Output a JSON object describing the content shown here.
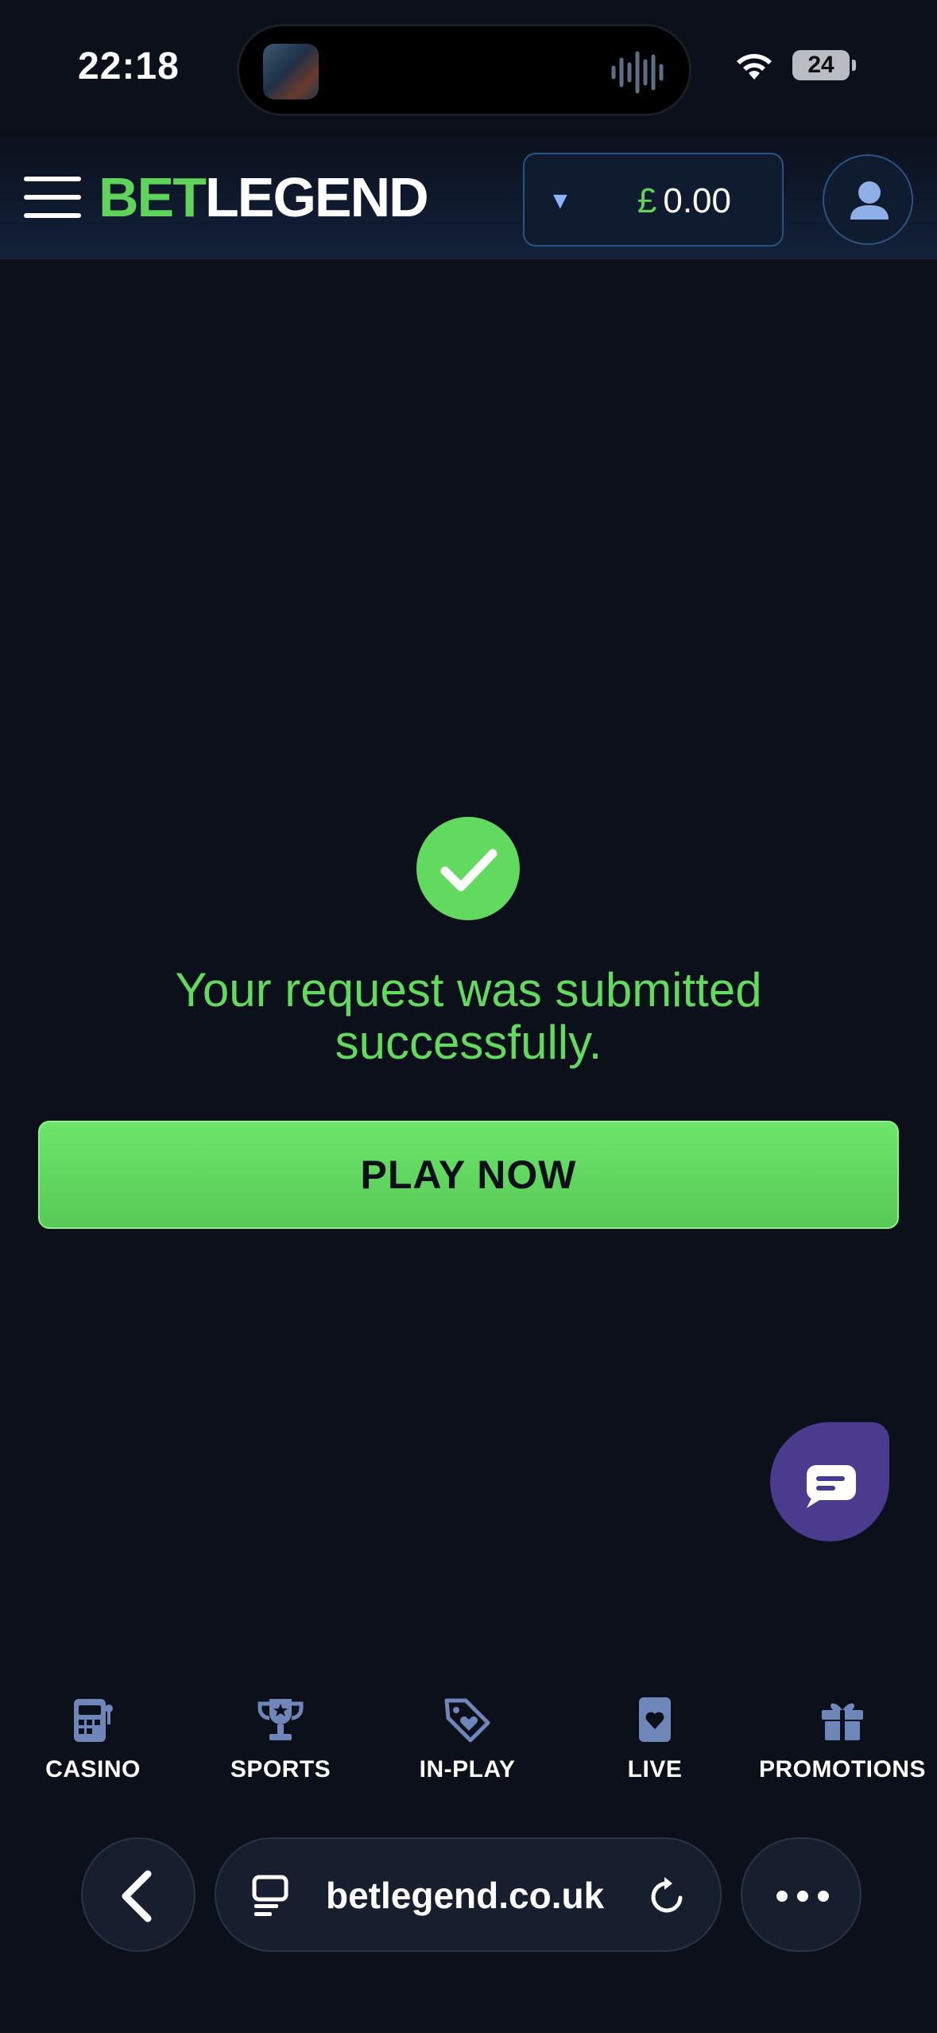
{
  "status_bar": {
    "time": "22:18",
    "battery": "24"
  },
  "header": {
    "logo_part1": "BET",
    "logo_part2": "LEGEND",
    "balance_currency": "£",
    "balance_value": "0.00",
    "dropdown_arrow": "▼"
  },
  "main": {
    "success_message": "Your request was submitted successfully.",
    "play_button_label": "PLAY NOW"
  },
  "bottom_nav": {
    "items": [
      {
        "label": "CASINO",
        "icon": "slot-machine-icon"
      },
      {
        "label": "SPORTS",
        "icon": "trophy-icon"
      },
      {
        "label": "IN-PLAY",
        "icon": "tag-heart-icon"
      },
      {
        "label": "LIVE",
        "icon": "playing-card-icon"
      },
      {
        "label": "PROMOTIONS",
        "icon": "gift-icon"
      }
    ]
  },
  "browser": {
    "url": "betlegend.co.uk"
  },
  "colors": {
    "accent_green": "#62d95f",
    "background": "#0b101b",
    "chat": "#4a3b8f",
    "nav_icon": "#6f86b8"
  }
}
